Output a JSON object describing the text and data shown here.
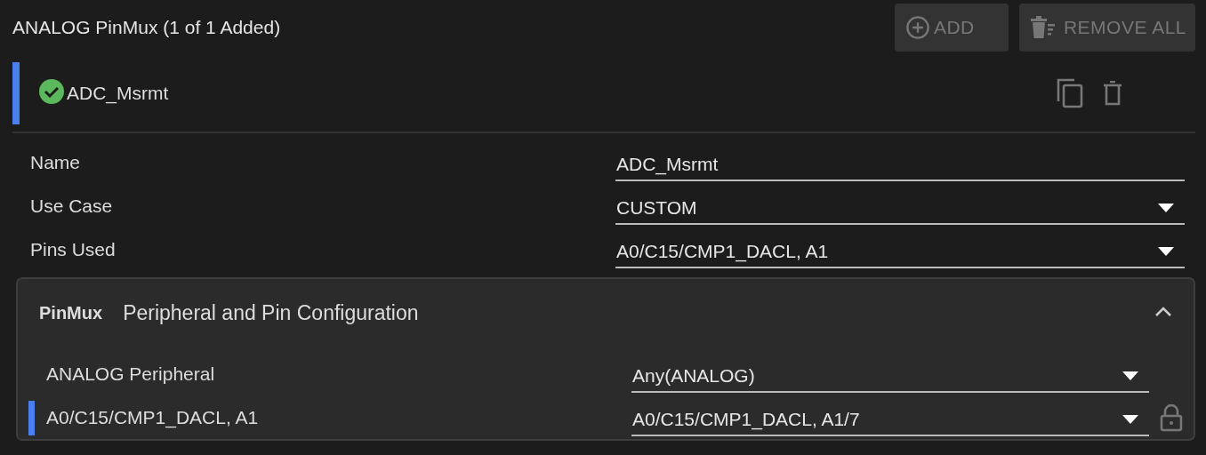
{
  "header": {
    "title": "ANALOG PinMux (1 of 1 Added)",
    "buttons": [
      {
        "kind": "add",
        "label": "ADD",
        "disabled": true
      },
      {
        "kind": "remove_all",
        "label": "REMOVE ALL",
        "disabled": true
      }
    ]
  },
  "instance": {
    "name": "ADC_Msrmt",
    "selected": true,
    "valid": true
  },
  "fields": [
    {
      "label": "Name",
      "value": "ADC_Msrmt",
      "kind": "text"
    },
    {
      "label": "Use Case",
      "value": "CUSTOM",
      "kind": "select"
    },
    {
      "label": "Pins Used",
      "value": "A0/C15/CMP1_DACL, A1",
      "kind": "select"
    }
  ],
  "panel": {
    "badge": "PinMux",
    "title": "Peripheral and Pin Configuration",
    "expanded": true,
    "rows": [
      {
        "label": "ANALOG Peripheral",
        "value": "Any(ANALOG)",
        "selected": false,
        "locked": false
      },
      {
        "label": "A0/C15/CMP1_DACL, A1",
        "value": "A0/C15/CMP1_DACL, A1/7",
        "selected": true,
        "locked": true
      }
    ]
  }
}
